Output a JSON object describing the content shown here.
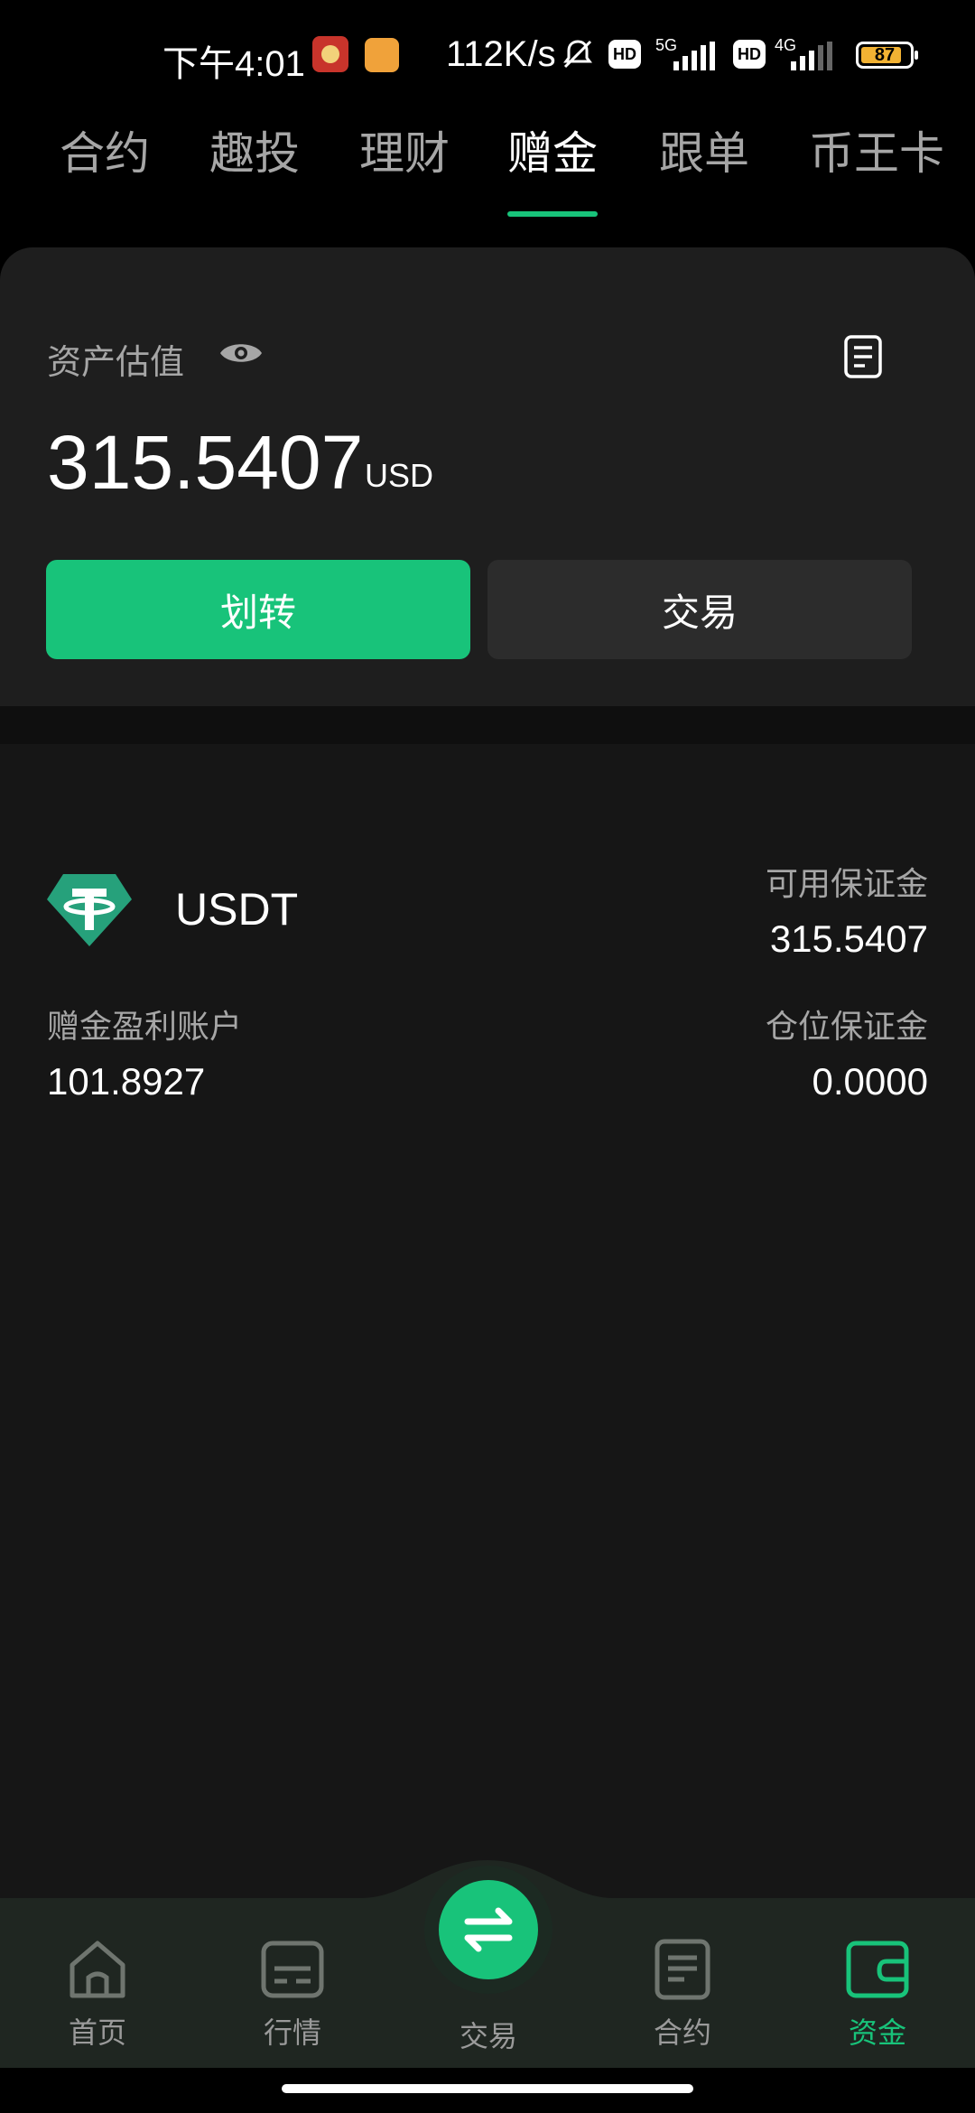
{
  "status_bar": {
    "time": "下午4:01",
    "speed": "112K/s",
    "hd1": "HD",
    "net1": "5G",
    "hd2": "HD",
    "net2": "4G",
    "battery": "87"
  },
  "tabs": [
    {
      "label": "合约",
      "active": false
    },
    {
      "label": "趣投",
      "active": false
    },
    {
      "label": "理财",
      "active": false
    },
    {
      "label": "赠金",
      "active": true
    },
    {
      "label": "跟单",
      "active": false
    },
    {
      "label": "币王卡",
      "active": false
    }
  ],
  "asset": {
    "label": "资产估值",
    "amount": "315.5407",
    "unit": "USD",
    "transfer_label": "划转",
    "trade_label": "交易"
  },
  "account": {
    "coin": "USDT",
    "available_label": "可用保证金",
    "available_value": "315.5407",
    "profit_label": "赠金盈利账户",
    "profit_value": "101.8927",
    "position_label": "仓位保证金",
    "position_value": "0.0000"
  },
  "nav": [
    {
      "label": "首页",
      "icon": "home-icon"
    },
    {
      "label": "行情",
      "icon": "market-icon"
    },
    {
      "label": "交易",
      "icon": "swap-icon"
    },
    {
      "label": "合约",
      "icon": "contract-icon"
    },
    {
      "label": "资金",
      "icon": "wallet-icon"
    }
  ],
  "colors": {
    "accent": "#18c37a",
    "background": "#161616",
    "card": "#1e1e1e"
  }
}
